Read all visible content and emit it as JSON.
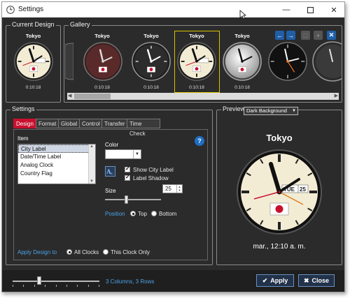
{
  "window": {
    "title": "Settings"
  },
  "current_design": {
    "label": "Current Design",
    "city": "Tokyo",
    "time": "0:10:18"
  },
  "gallery": {
    "label": "Gallery",
    "clocks": [
      {
        "city": "Tokyo",
        "time": "0:10:18",
        "style": "dark-red"
      },
      {
        "city": "Tokyo",
        "time": "0:10:18",
        "style": "dark"
      },
      {
        "city": "Tokyo",
        "time": "0:10:18",
        "style": "cream",
        "selected": true
      },
      {
        "city": "Tokyo",
        "time": "0:10:18",
        "style": "silver"
      },
      {
        "city": "",
        "time": "",
        "style": "black-orange"
      },
      {
        "city": "",
        "time": "",
        "style": "black"
      }
    ]
  },
  "settings": {
    "label": "Settings",
    "tabs": [
      "Design",
      "Format",
      "Global",
      "Control",
      "Transfer",
      "Time Check"
    ],
    "active_tab": "Design",
    "item_label": "Item",
    "items": [
      "City Label",
      "Date/Time Label",
      "Analog Clock",
      "Country Flag"
    ],
    "selected_item": "City Label",
    "color_label": "Color",
    "show_city_label": "Show City Label",
    "label_shadow": "Label Shadow",
    "size_label": "Size",
    "size_value": "25",
    "position_label": "Position",
    "position_options": [
      "Top",
      "Bottom"
    ],
    "position_selected": "Top",
    "apply_label": "Apply Design to",
    "apply_options": [
      "All Clocks",
      "This Clock Only"
    ],
    "apply_selected": "All Clocks",
    "help": "?"
  },
  "preview": {
    "label": "Preview",
    "background_option": "Dark Background",
    "city": "Tokyo",
    "date_window": "TUE",
    "date_number": "25",
    "datetime": "mar., 12:10 a. m."
  },
  "footer": {
    "grid_text": "3 Columns, 3 Rows",
    "grid_slider_fraction": 0.3,
    "apply_button": "Apply",
    "close_button": "Close"
  },
  "colors": {
    "accent_red": "#c8102e",
    "link_blue": "#4aa3e8",
    "selection_yellow": "#d8c200",
    "button_blue": "#1f5fa8"
  }
}
